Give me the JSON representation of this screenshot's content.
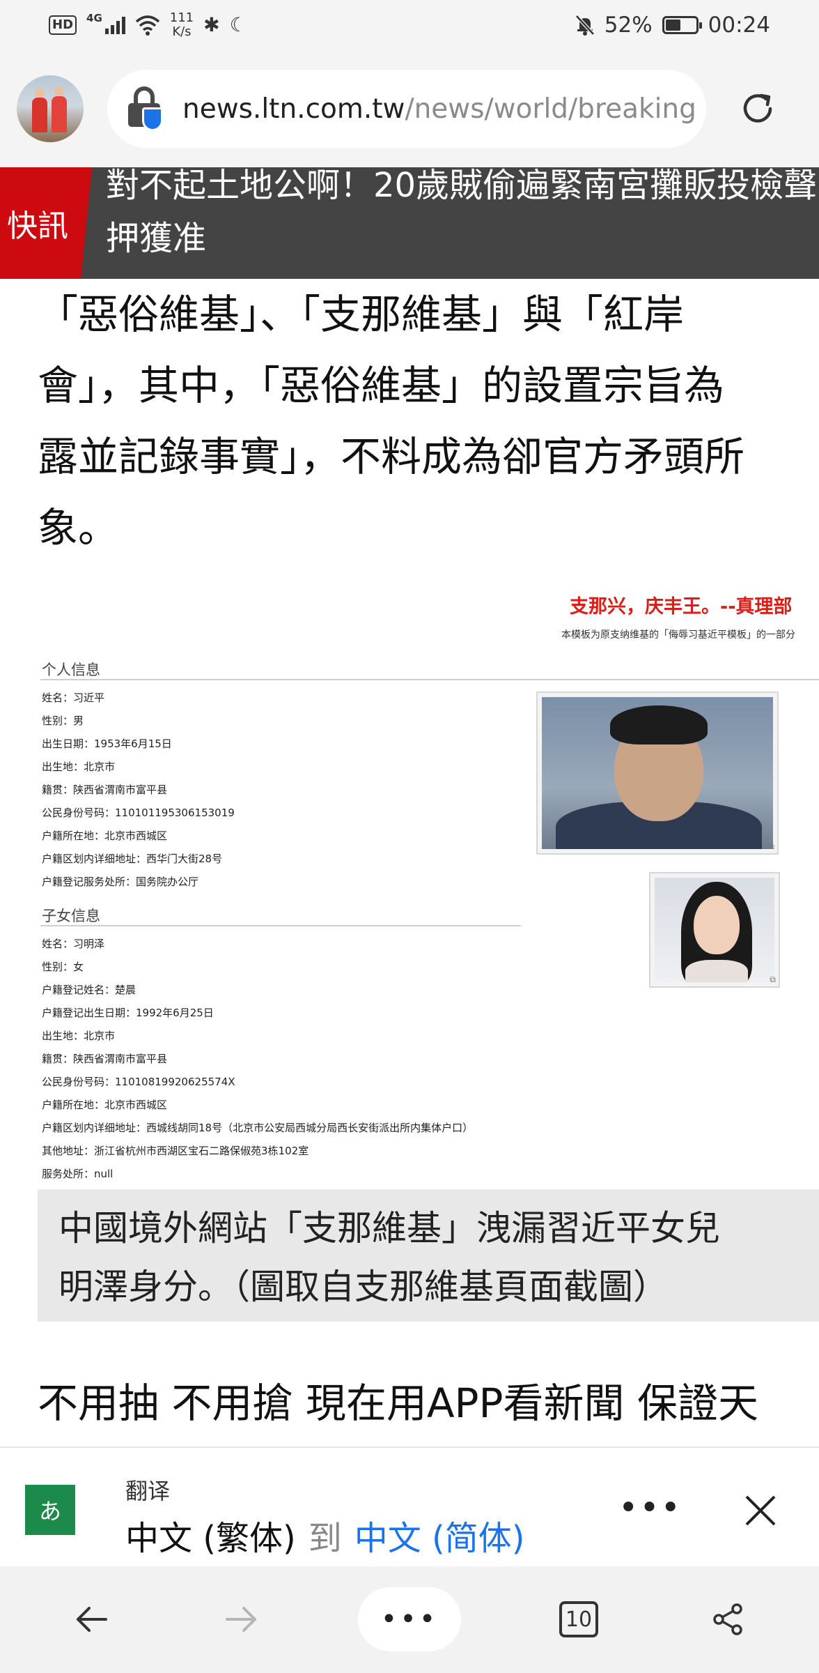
{
  "status_bar": {
    "hd": "HD",
    "network": "4G",
    "speed_value": "111",
    "speed_unit": "K/s",
    "battery": "52%",
    "battery_level": 0.52,
    "time": "00:24"
  },
  "address_bar": {
    "url_domain": "news.ltn.com.tw",
    "url_path": "/news/world/breaking"
  },
  "breaking": {
    "tag": "快訊",
    "headline": "對不起土地公啊！20歲賊偷遍緊南宮攤販投檢聲押獲准"
  },
  "article": {
    "lines": [
      "「惡俗維基」、「支那維基」與「紅岸",
      "會」，其中，「惡俗維基」的設置宗旨為",
      "露並記錄事實」，不料成為卻官方矛頭所",
      "象。"
    ],
    "promo": "不用抽 不用搶 現在用APP看新聞 保證天"
  },
  "figure": {
    "red_title": "支那兴，庆丰王。--真理部",
    "red_subtitle": "本模板为原支纳维基的「侮辱习基近平模板」的一部分",
    "personal_section": "个人信息",
    "personal_fields": [
      "姓名：习近平",
      "性别：男",
      "出生日期：1953年6月15日",
      "出生地：北京市",
      "籍贯：陕西省渭南市富平县",
      "公民身份号码：110101195306153019",
      "户籍所在地：北京市西城区",
      "户籍区划内详细地址：西华门大街28号",
      "户籍登记服务处所：国务院办公厅"
    ],
    "children_section": "子女信息",
    "children_fields": [
      "姓名：习明泽",
      "性别：女",
      "户籍登记姓名：楚晨",
      "户籍登记出生日期：1992年6月25日",
      "出生地：北京市",
      "籍贯：陕西省渭南市富平县",
      "公民身份号码：11010819920625574X",
      "户籍所在地：北京市西城区",
      "户籍区划内详细地址：西城线胡同18号（北京市公安局西城分局西长安街派出所内集体户口）",
      "其他地址：浙江省杭州市西湖区宝石二路保俶苑3栋102室",
      "服务处所：null"
    ]
  },
  "caption": {
    "lines": [
      "中國境外網站「支那維基」洩漏習近平女兒",
      "明澤身分。（圖取自支那維基頁面截圖）"
    ]
  },
  "translate_bar": {
    "label": "翻译",
    "from_lang": "中文 (繁体)",
    "to_word": "到",
    "to_lang": "中文 (简体)",
    "more": "•••"
  },
  "bottom_nav": {
    "menu": "•••",
    "tab_count": "10"
  },
  "colors": {
    "breaking_red": "#cc0a0f",
    "banner_gray": "#444444",
    "link_blue": "#1a73e8",
    "translate_green": "#1b8a4a"
  }
}
